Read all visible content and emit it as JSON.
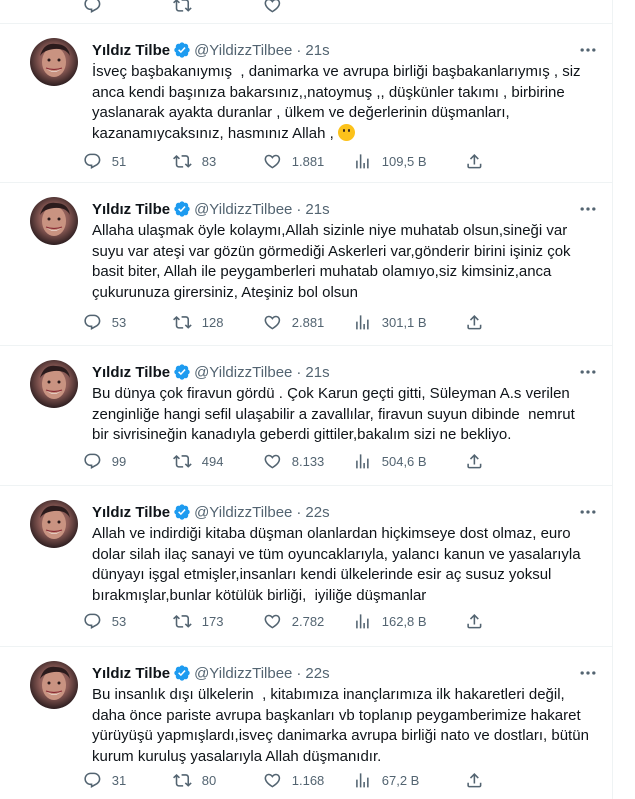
{
  "user": {
    "name": "Yıldız Tilbe",
    "handle": "@YildizzTilbee",
    "separator": "·"
  },
  "tweets": [
    {
      "time": "21s",
      "text": "İsveç başbakanıymış  , danimarka ve avrupa birliği başbakanlarıymış , siz anca kendi başınıza bakarsınız,,natoymuş ,, düşkünler takımı , birbirine yaslanarak ayakta duranlar , ülkem ve değerlerinin düşmanları, kazanamıycaksınız, hasmınız Allah , ",
      "emoji": "thinking-face",
      "replies": "51",
      "retweets": "83",
      "likes": "1.881",
      "views": "109,5 B"
    },
    {
      "time": "21s",
      "text": "Allaha ulaşmak öyle kolaymı,Allah sizinle niye muhatab olsun,sineği var suyu var ateşi var gözün görmediği Askerleri var,gönderir birini işiniz çok basit biter, Allah ile peygamberleri muhatab olamıyo,siz kimsiniz,anca çukurunuza girersiniz, Ateşiniz bol olsun",
      "replies": "53",
      "retweets": "128",
      "likes": "2.881",
      "views": "301,1 B"
    },
    {
      "time": "21s",
      "text": "Bu dünya çok firavun gördü . Çok Karun geçti gitti, Süleyman A.s verilen zenginliğe hangi sefil ulaşabilir a zavallılar, firavun suyun dibinde  nemrut bir sivrisineğin kanadıyla geberdi gittiler,bakalım sizi ne bekliyo.",
      "replies": "99",
      "retweets": "494",
      "likes": "8.133",
      "views": "504,6 B"
    },
    {
      "time": "22s",
      "text": "Allah ve indirdiği kitaba düşman olanlardan hiçkimseye dost olmaz, euro dolar silah ilaç sanayi ve tüm oyuncaklarıyla, yalancı kanun ve yasalarıyla dünyayı işgal etmişler,insanları kendi ülkelerinde esir aç susuz yoksul bırakmışlar,bunlar kötülük birliği,  iyiliğe düşmanlar",
      "replies": "53",
      "retweets": "173",
      "likes": "2.782",
      "views": "162,8 B"
    },
    {
      "time": "22s",
      "text": "Bu insanlık dışı ülkelerin  , kitabımıza inançlarımıza ilk hakaretleri değil, daha önce pariste avrupa başkanları vb toplanıp peygamberimize hakaret yürüyüşü yapmışlardı,isveç danimarka avrupa birliği nato ve dostları, bütün kurum kuruluş yasalarıyla Allah düşmanıdır.",
      "replies": "31",
      "retweets": "80",
      "likes": "1.168",
      "views": "67,2 B"
    }
  ],
  "colors": {
    "verified": "#1d9bf0",
    "muted": "#536471",
    "text": "#0f1419",
    "divider": "#eff3f4"
  }
}
